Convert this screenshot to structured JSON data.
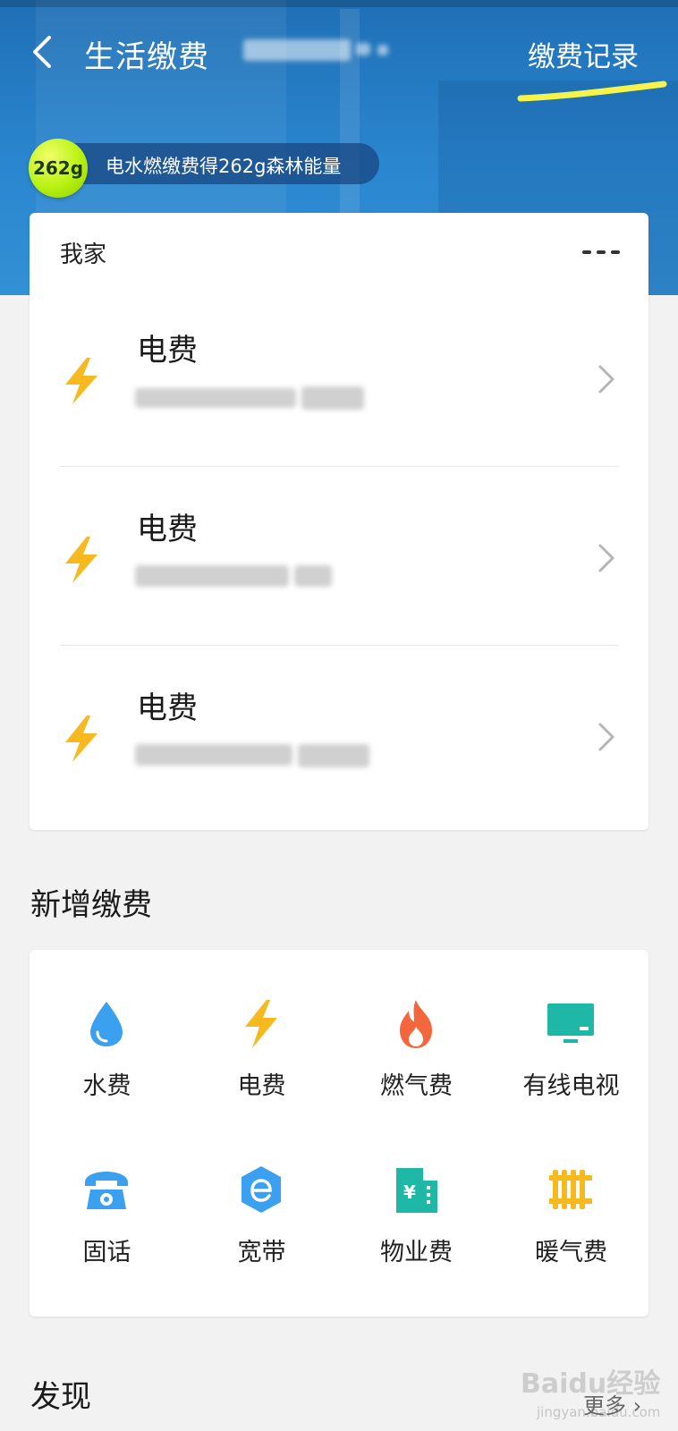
{
  "header": {
    "title": "生活缴费",
    "record_link": "缴费记录",
    "energy_badge": "262g",
    "energy_text": "电水燃缴费得262g森林能量"
  },
  "home_card": {
    "title": "我家",
    "bills": [
      {
        "label": "电费"
      },
      {
        "label": "电费"
      },
      {
        "label": "电费"
      }
    ]
  },
  "new_payment": {
    "title": "新增缴费",
    "items": [
      {
        "label": "水费",
        "icon": "water-drop-icon",
        "color": "#3aa0ef"
      },
      {
        "label": "电费",
        "icon": "lightning-icon",
        "color": "#f6b91f"
      },
      {
        "label": "燃气费",
        "icon": "flame-icon",
        "color": "#f4663b"
      },
      {
        "label": "有线电视",
        "icon": "tv-icon",
        "color": "#1fb8a6"
      },
      {
        "label": "固话",
        "icon": "telephone-icon",
        "color": "#3aa0ef"
      },
      {
        "label": "宽带",
        "icon": "broadband-icon",
        "color": "#3aa0ef"
      },
      {
        "label": "物业费",
        "icon": "building-icon",
        "color": "#1fb8a6"
      },
      {
        "label": "暖气费",
        "icon": "radiator-icon",
        "color": "#f6b91f"
      }
    ]
  },
  "discover": {
    "title": "发现",
    "more_label": "更多"
  },
  "watermark": {
    "text": "Baidu经验",
    "sub": "jingyan.baidu.com"
  },
  "colors": {
    "header_blue": "#2a86cf",
    "highlight_yellow": "#f4f44a",
    "energy_green": "#b8f212"
  }
}
